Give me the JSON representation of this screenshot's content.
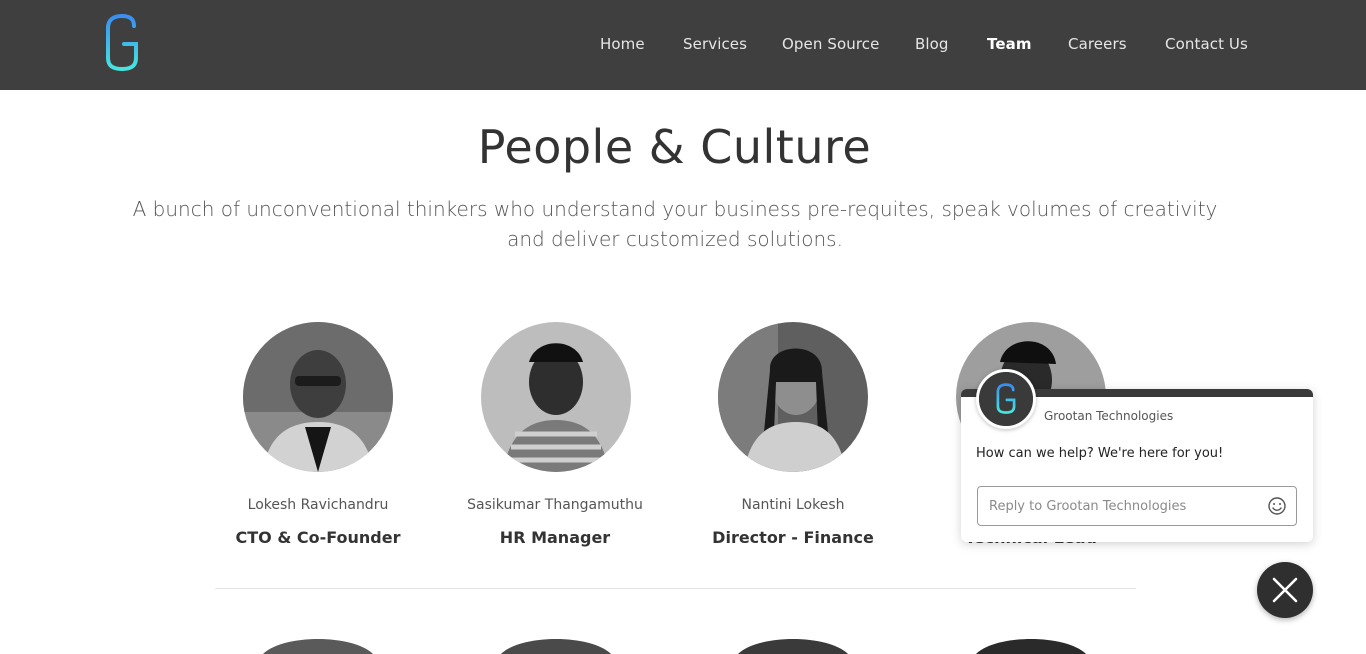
{
  "header": {
    "logo_icon": "grootan-g-logo",
    "nav": [
      {
        "label": "Home"
      },
      {
        "label": "Services"
      },
      {
        "label": "Open Source"
      },
      {
        "label": "Blog"
      },
      {
        "label": "Team",
        "active": true
      },
      {
        "label": "Careers"
      },
      {
        "label": "Contact Us"
      }
    ]
  },
  "hero": {
    "title": "People & Culture",
    "subtitle_line1": "A bunch of unconventional thinkers who understand your business pre-requites, speak volumes of creativity",
    "subtitle_line2": "and deliver customized solutions."
  },
  "team": [
    {
      "name": "Lokesh Ravichandru",
      "role": "CTO & Co-Founder"
    },
    {
      "name": "Sasikumar Thangamuthu",
      "role": "HR Manager"
    },
    {
      "name": "Nantini Lokesh",
      "role": "Director - Finance"
    },
    {
      "name": "",
      "role": "Technical Lead"
    }
  ],
  "chat": {
    "company": "Grootan Technologies",
    "message": "How can we help? We're here for you!",
    "input_placeholder": "Reply to Grootan Technologies",
    "emoji_icon": "smiley-icon",
    "close_icon": "close-icon"
  },
  "colors": {
    "header_bg": "#3f3f3f",
    "logo_gradient_start": "#3a8ef0",
    "logo_gradient_end": "#46e6e0",
    "chat_dark": "#2f2f2f"
  }
}
